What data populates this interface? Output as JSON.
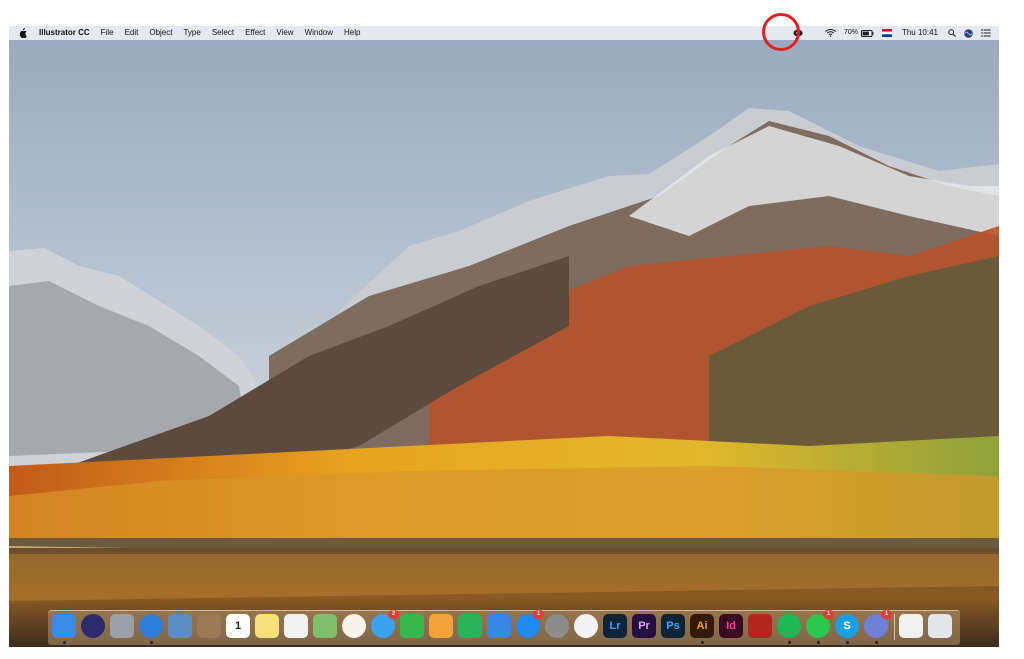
{
  "menubar": {
    "apple_icon": "apple-icon",
    "app_name": "Illustrator CC",
    "menus": [
      "File",
      "Edit",
      "Object",
      "Type",
      "Select",
      "Effect",
      "View",
      "Window",
      "Help"
    ],
    "status": {
      "screen_record_icon": "screen-record-icon",
      "wifi_icon": "wifi-icon",
      "battery_percent": "70%",
      "battery_icon": "battery-icon",
      "input_flag_icon": "netherlands-flag-icon",
      "clock": "Thu 10:41",
      "spotlight_icon": "spotlight-icon",
      "siri_icon": "siri-icon",
      "notification_icon": "notification-center-icon"
    }
  },
  "highlight": {
    "color": "#e21f1f",
    "target": "screen-record-icon"
  },
  "dock": {
    "apps": [
      {
        "name": "finder-icon",
        "label": "",
        "bg": "#3d8be8",
        "running": true
      },
      {
        "name": "siri-icon",
        "label": "",
        "bg": "#2c2c6c",
        "running": false
      },
      {
        "name": "launchpad-icon",
        "label": "",
        "bg": "#9aa0a8",
        "running": false
      },
      {
        "name": "safari-icon",
        "label": "",
        "bg": "#2e7fdc",
        "running": true
      },
      {
        "name": "preview-icon",
        "label": "",
        "bg": "#5a8ec2",
        "running": false
      },
      {
        "name": "notefile-icon",
        "label": "",
        "bg": "#9b7a55",
        "running": false
      },
      {
        "name": "calendar-icon",
        "label": "1",
        "bg": "#ffffff",
        "running": false
      },
      {
        "name": "notes-icon",
        "label": "",
        "bg": "#f5e07a",
        "running": false
      },
      {
        "name": "reminders-icon",
        "label": "",
        "bg": "#f2f2f2",
        "running": false
      },
      {
        "name": "maps-icon",
        "label": "",
        "bg": "#7fbf6a",
        "running": false
      },
      {
        "name": "photos-icon",
        "label": "",
        "bg": "#f7f2ea",
        "running": false
      },
      {
        "name": "messages-icon",
        "label": "",
        "bg": "#3aa3ef",
        "running": false,
        "badge": "2"
      },
      {
        "name": "facetime-icon",
        "label": "",
        "bg": "#37b64a",
        "running": false
      },
      {
        "name": "pages-icon",
        "label": "",
        "bg": "#f2a33b",
        "running": false
      },
      {
        "name": "numbers-icon",
        "label": "",
        "bg": "#2bb35b",
        "running": false
      },
      {
        "name": "keynote-icon",
        "label": "",
        "bg": "#3a88e6",
        "running": false
      },
      {
        "name": "app-store-icon",
        "label": "",
        "bg": "#1f8bf0",
        "running": false,
        "badge": "1"
      },
      {
        "name": "system-preferences-icon",
        "label": "",
        "bg": "#8c8c8c",
        "running": false
      },
      {
        "name": "itunes-icon",
        "label": "",
        "bg": "#f3f3f6",
        "running": false
      },
      {
        "name": "lightroom-icon",
        "label": "Lr",
        "bg": "#0f2438",
        "running": false
      },
      {
        "name": "premiere-icon",
        "label": "Pr",
        "bg": "#24103f",
        "running": false
      },
      {
        "name": "photoshop-icon",
        "label": "Ps",
        "bg": "#0c2338",
        "running": false
      },
      {
        "name": "illustrator-icon",
        "label": "Ai",
        "bg": "#321a04",
        "running": true
      },
      {
        "name": "indesign-icon",
        "label": "Id",
        "bg": "#3a0b22",
        "running": false
      },
      {
        "name": "filezilla-icon",
        "label": "",
        "bg": "#b3261e",
        "running": false
      },
      {
        "name": "spotify-icon",
        "label": "",
        "bg": "#1db954",
        "running": true
      },
      {
        "name": "whatsapp-icon",
        "label": "",
        "bg": "#2cc84d",
        "running": true,
        "badge": "1"
      },
      {
        "name": "skype-icon",
        "label": "S",
        "bg": "#1aa0e6",
        "running": true
      },
      {
        "name": "discord-icon",
        "label": "",
        "bg": "#6f7fd6",
        "running": true,
        "badge": "1"
      },
      {
        "name": "camper-app-icon",
        "label": "",
        "bg": "#f1f1f1",
        "running": false
      },
      {
        "name": "trash-icon",
        "label": "",
        "bg": "#e3e6ea",
        "running": false
      }
    ]
  }
}
